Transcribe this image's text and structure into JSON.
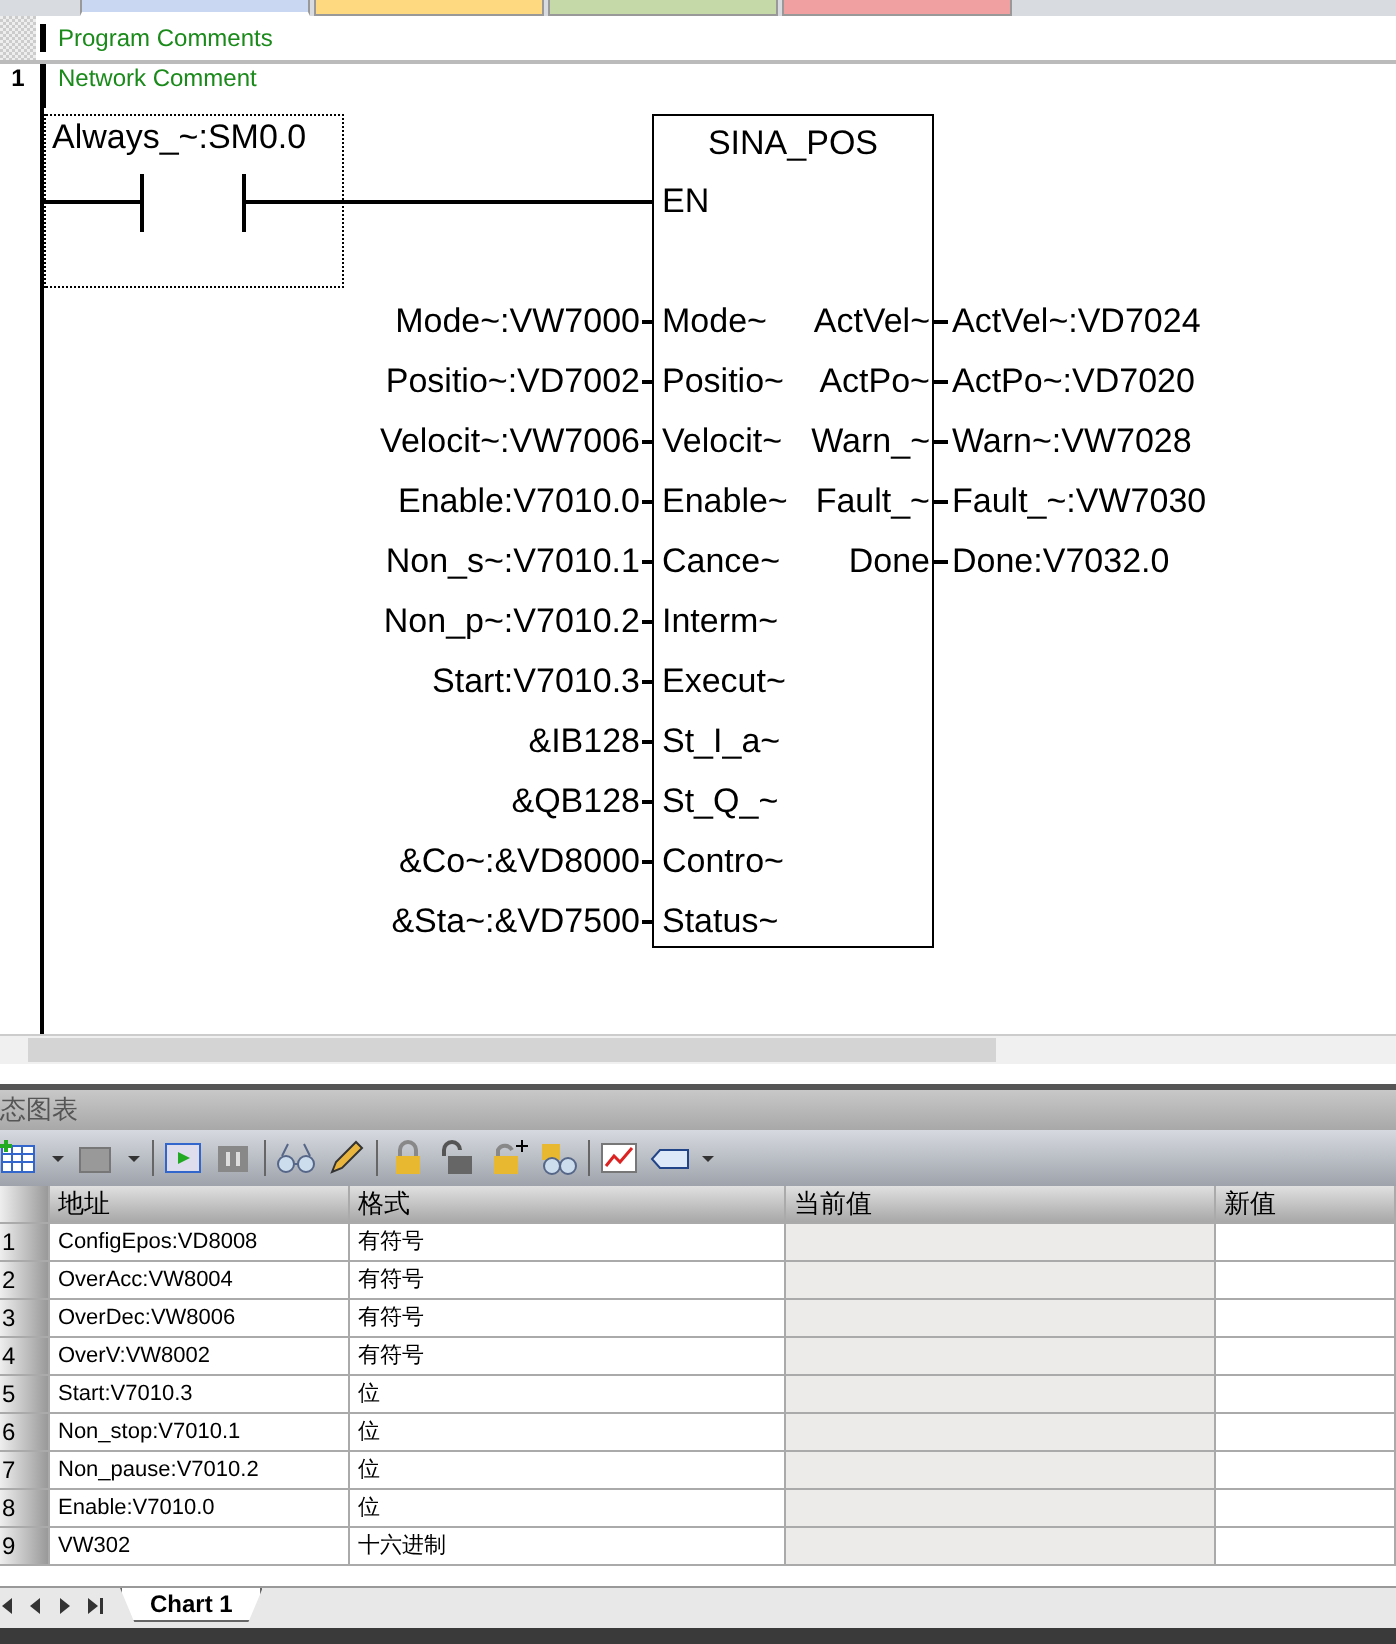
{
  "editor_tabs": [
    {
      "color": "#c9d7f2",
      "selected": true
    },
    {
      "color": "#ffd980",
      "selected": false
    },
    {
      "color": "#c4d8a8",
      "selected": false
    },
    {
      "color": "#f0a0a0",
      "selected": false
    }
  ],
  "program_comment": "Program Comments",
  "network": {
    "number": "1",
    "comment": "Network Comment",
    "contact": {
      "label": "Always_~:SM0.0"
    },
    "block": {
      "title": "SINA_POS",
      "enable_pin": "EN",
      "inputs": [
        {
          "operand": "Mode~:VW7000",
          "pin": "Mode~"
        },
        {
          "operand": "Positio~:VD7002",
          "pin": "Positio~"
        },
        {
          "operand": "Velocit~:VW7006",
          "pin": "Velocit~"
        },
        {
          "operand": "Enable:V7010.0",
          "pin": "Enable~"
        },
        {
          "operand": "Non_s~:V7010.1",
          "pin": "Cance~"
        },
        {
          "operand": "Non_p~:V7010.2",
          "pin": "Interm~"
        },
        {
          "operand": "Start:V7010.3",
          "pin": "Execut~"
        },
        {
          "operand": "&IB128",
          "pin": "St_I_a~"
        },
        {
          "operand": "&QB128",
          "pin": "St_Q_~"
        },
        {
          "operand": "&Co~:&VD8000",
          "pin": "Contro~"
        },
        {
          "operand": "&Sta~:&VD7500",
          "pin": "Status~"
        }
      ],
      "outputs": [
        {
          "pin": "ActVel~",
          "operand": "ActVel~:VD7024"
        },
        {
          "pin": "ActPo~",
          "operand": "ActPo~:VD7020"
        },
        {
          "pin": "Warn_~",
          "operand": "Warn~:VW7028"
        },
        {
          "pin": "Fault_~",
          "operand": "Fault_~:VW7030"
        },
        {
          "pin": "Done",
          "operand": "Done:V7032.0"
        }
      ]
    }
  },
  "status_chart": {
    "title": "态图表",
    "columns": [
      "地址",
      "格式",
      "当前值",
      "新值"
    ],
    "rows": [
      {
        "number": "1",
        "address": "ConfigEpos:VD8008",
        "format": "有符号"
      },
      {
        "number": "2",
        "address": "OverAcc:VW8004",
        "format": "有符号"
      },
      {
        "number": "3",
        "address": "OverDec:VW8006",
        "format": "有符号"
      },
      {
        "number": "4",
        "address": "OverV:VW8002",
        "format": "有符号"
      },
      {
        "number": "5",
        "address": "Start:V7010.3",
        "format": "位"
      },
      {
        "number": "6",
        "address": "Non_stop:V7010.1",
        "format": "位"
      },
      {
        "number": "7",
        "address": "Non_pause:V7010.2",
        "format": "位"
      },
      {
        "number": "8",
        "address": "Enable:V7010.0",
        "format": "位"
      },
      {
        "number": "9",
        "address": "VW302",
        "format": "十六进制"
      }
    ],
    "sheet_tabs": [
      {
        "label": "Chart 1",
        "selected": true
      }
    ]
  }
}
